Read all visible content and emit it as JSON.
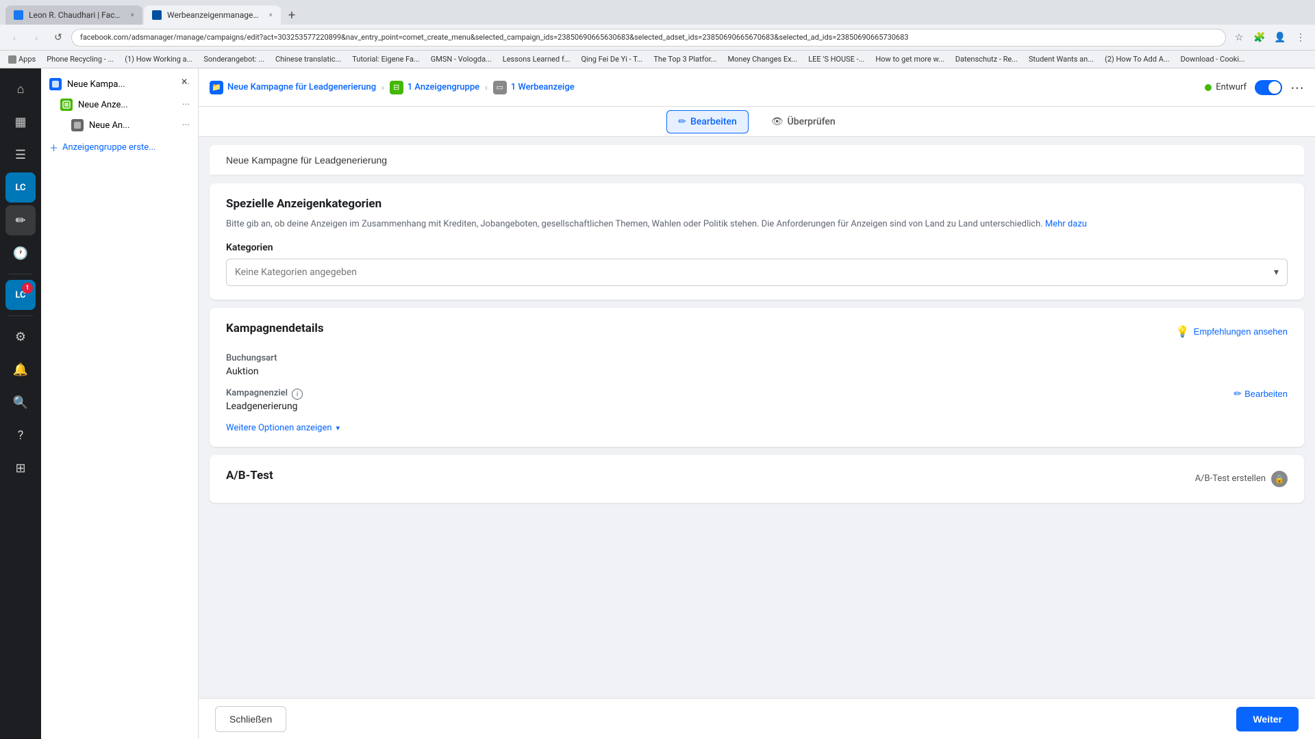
{
  "browser": {
    "tabs": [
      {
        "id": "tab-facebook",
        "label": "Leon R. Chaudhari | Facebook",
        "active": false,
        "favicon": "fb"
      },
      {
        "id": "tab-ads",
        "label": "Werbeanzeigenmanager - We...",
        "active": true,
        "favicon": "ads"
      }
    ],
    "address": "facebook.com/adsmanager/manage/campaigns/edit?act=303253577220899&nav_entry_point=comet_create_menu&selected_campaign_ids=23850690665630683&selected_adset_ids=23850690665670683&selected_ad_ids=23850690665730683",
    "bookmarks": [
      {
        "label": "Apps"
      },
      {
        "label": "Phone Recycling - ..."
      },
      {
        "label": "(1) How Working a..."
      },
      {
        "label": "Sonderangebot: ..."
      },
      {
        "label": "Chinese translatic..."
      },
      {
        "label": "Tutorial: Eigene Fa..."
      },
      {
        "label": "GMSN - Vologda..."
      },
      {
        "label": "Lessons Learned f..."
      },
      {
        "label": "Qing Fei De Yi - T..."
      },
      {
        "label": "The Top 3 Platfor..."
      },
      {
        "label": "Money Changes Ex..."
      },
      {
        "label": "LEE 'S HOUSE -..."
      },
      {
        "label": "How to get more w..."
      },
      {
        "label": "Datenschutz - Re..."
      },
      {
        "label": "Student Wants an..."
      },
      {
        "label": "(2) How To Add A..."
      },
      {
        "label": "Download - Cooki..."
      }
    ]
  },
  "sidebar_icons": [
    {
      "id": "home",
      "icon": "⌂",
      "active": false
    },
    {
      "id": "chart",
      "icon": "📊",
      "active": false
    },
    {
      "id": "menu",
      "icon": "☰",
      "active": false
    },
    {
      "id": "avatar",
      "icon": "LC",
      "active": false,
      "badge": null
    },
    {
      "id": "edit",
      "icon": "✏",
      "active": true
    },
    {
      "id": "clock",
      "icon": "🕐",
      "active": false
    },
    {
      "id": "avatar2",
      "icon": "LC",
      "active": false,
      "badge": "1"
    },
    {
      "id": "grid",
      "icon": "⊞",
      "active": false
    }
  ],
  "campaign_tree": {
    "close_btn": "×",
    "items": [
      {
        "id": "campaign",
        "label": "Neue Kampa...",
        "level": 1,
        "type": "campaign"
      },
      {
        "id": "adgroup",
        "label": "Neue Anze...",
        "level": 2,
        "type": "adgroup"
      },
      {
        "id": "ad",
        "label": "Neue An...",
        "level": 3,
        "type": "ad"
      }
    ],
    "add_group_label": "Anzeigengruppe erste..."
  },
  "top_bar": {
    "breadcrumbs": [
      {
        "id": "bc-campaign",
        "label": "Neue Kampagne für Leadgenerierung",
        "type": "campaign"
      },
      {
        "id": "bc-adgroup",
        "label": "1 Anzeigengruppe",
        "type": "adgroup"
      },
      {
        "id": "bc-ad",
        "label": "1 Werbeanzeige",
        "type": "ad"
      }
    ],
    "status": "Entwurf",
    "more_btn": "⋯"
  },
  "action_bar": {
    "bearbeiten_label": "Bearbeiten",
    "ueberpruefen_label": "Überprüfen"
  },
  "campaign_title": {
    "value": "Neue Kampagne für Leadgenerierung"
  },
  "spezielle_anzeigenkategorien": {
    "title": "Spezielle Anzeigenkategorien",
    "description": "Bitte gib an, ob deine Anzeigen im Zusammenhang mit Krediten, Jobangeboten, gesellschaftlichen Themen, Wahlen oder Politik stehen. Die Anforderungen für Anzeigen sind von Land zu Land unterschiedlich.",
    "mehr_dazu": "Mehr dazu",
    "kategorien_label": "Kategorien",
    "select_placeholder": "Keine Kategorien angegeben"
  },
  "kampagnendetails": {
    "title": "Kampagnendetails",
    "empfehlung_label": "Empfehlungen ansehen",
    "buchungsart_label": "Buchungsart",
    "buchungsart_value": "Auktion",
    "kampagnenziel_label": "Kampagnenziel",
    "kampagnenziel_value": "Leadgenerierung",
    "bearbeiten_label": "Bearbeiten",
    "weitere_optionen_label": "Weitere Optionen anzeigen"
  },
  "ab_test": {
    "title": "A/B-Test",
    "erstellen_label": "A/B-Test erstellen"
  },
  "bottom_bar": {
    "schliessen_label": "Schließen",
    "weiter_label": "Weiter"
  }
}
